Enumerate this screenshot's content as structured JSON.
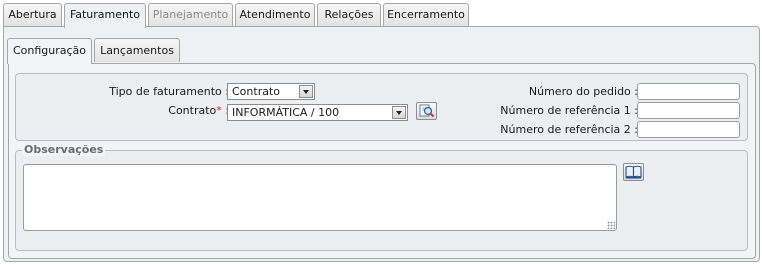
{
  "tabs": [
    {
      "label": "Abertura",
      "state": "normal"
    },
    {
      "label": "Faturamento",
      "state": "active"
    },
    {
      "label": "Planejamento",
      "state": "disabled"
    },
    {
      "label": "Atendimento",
      "state": "normal"
    },
    {
      "label": "Relações",
      "state": "normal"
    },
    {
      "label": "Encerramento",
      "state": "normal"
    }
  ],
  "subtabs": [
    {
      "label": "Configuração",
      "state": "active"
    },
    {
      "label": "Lançamentos",
      "state": "normal"
    }
  ],
  "form": {
    "tipo_faturamento": {
      "label": "Tipo de faturamento :",
      "value": "Contrato"
    },
    "contrato": {
      "label": "Contrato",
      "required_mark": "*",
      "colon": ":",
      "value": "INFORMÁTICA / 100"
    },
    "numero_pedido": {
      "label": "Número do pedido :",
      "value": ""
    },
    "numero_ref1": {
      "label": "Número de referência 1 :",
      "value": ""
    },
    "numero_ref2": {
      "label": "Número de referência 2 :",
      "value": ""
    }
  },
  "observacoes": {
    "legend": "Observações",
    "value": ""
  },
  "icons": {
    "lookup": "search-lookup-icon",
    "book": "book-icon"
  },
  "colors": {
    "required": "#d42020",
    "panel_bg": "#eef0f3",
    "border": "#a6a6a6"
  }
}
